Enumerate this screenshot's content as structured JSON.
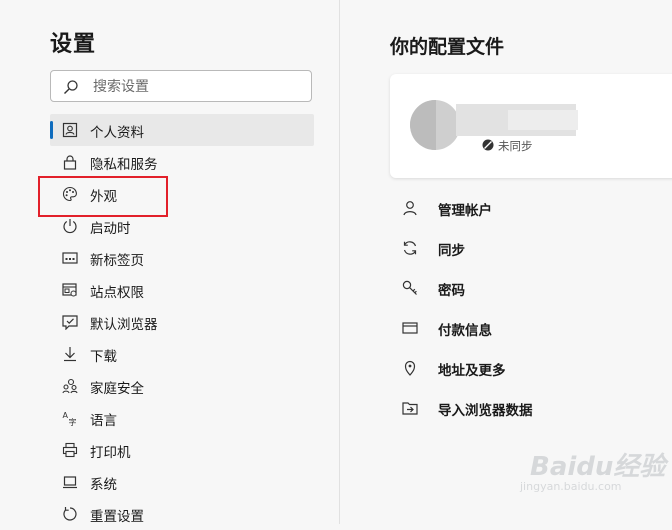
{
  "settings": {
    "title": "设置",
    "search_placeholder": "搜索设置",
    "nav": [
      {
        "label": "个人资料",
        "icon": "profile-icon",
        "active": true
      },
      {
        "label": "隐私和服务",
        "icon": "lock-icon"
      },
      {
        "label": "外观",
        "icon": "palette-icon"
      },
      {
        "label": "启动时",
        "icon": "power-icon"
      },
      {
        "label": "新标签页",
        "icon": "new-tab-icon"
      },
      {
        "label": "站点权限",
        "icon": "site-permissions-icon"
      },
      {
        "label": "默认浏览器",
        "icon": "default-browser-icon"
      },
      {
        "label": "下载",
        "icon": "download-icon"
      },
      {
        "label": "家庭安全",
        "icon": "family-icon"
      },
      {
        "label": "语言",
        "icon": "language-icon"
      },
      {
        "label": "打印机",
        "icon": "printer-icon"
      },
      {
        "label": "系统",
        "icon": "system-icon"
      },
      {
        "label": "重置设置",
        "icon": "reset-icon"
      }
    ]
  },
  "profile": {
    "title": "你的配置文件",
    "sync_status": "未同步",
    "items": [
      {
        "label": "管理帐户",
        "icon": "person-icon"
      },
      {
        "label": "同步",
        "icon": "sync-icon"
      },
      {
        "label": "密码",
        "icon": "key-icon"
      },
      {
        "label": "付款信息",
        "icon": "card-icon"
      },
      {
        "label": "地址及更多",
        "icon": "location-icon"
      },
      {
        "label": "导入浏览器数据",
        "icon": "import-icon"
      }
    ]
  },
  "watermark": {
    "brand": "Baidu经验",
    "url": "jingyan.baidu.com"
  },
  "colors": {
    "accent": "#0f6cbd",
    "highlight": "#e2202a"
  }
}
